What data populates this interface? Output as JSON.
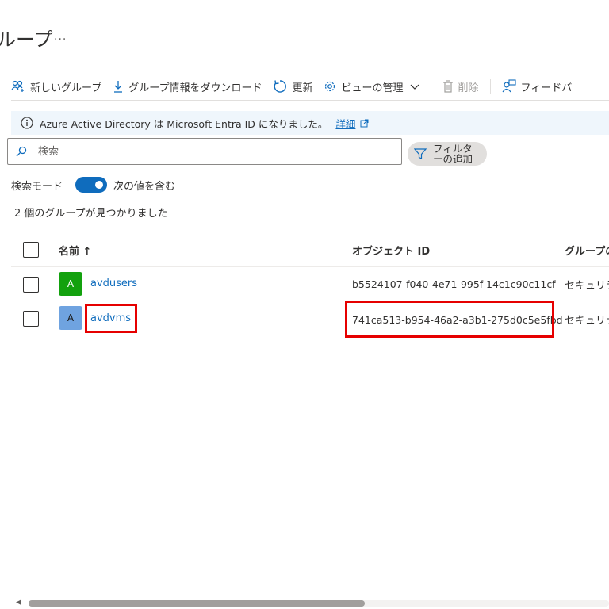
{
  "page": {
    "title": "ループ",
    "more": "..."
  },
  "toolbar": {
    "new_group": "新しいグループ",
    "download": "グループ情報をダウンロード",
    "refresh": "更新",
    "manage_view": "ビューの管理",
    "delete": "削除",
    "feedback": "フィードバ"
  },
  "banner": {
    "message": "Azure Active Directory は Microsoft Entra ID になりました。",
    "link": "詳細"
  },
  "search": {
    "placeholder": "検索"
  },
  "filter": {
    "label": "フィルターの追加"
  },
  "mode": {
    "label": "検索モード",
    "value": "次の値を含む",
    "enabled": true
  },
  "results": {
    "count_text": "2 個のグループが見つかりました"
  },
  "table": {
    "columns": {
      "name": "名前 ↑",
      "object_id": "オブジェクト ID",
      "group_type": "グループの"
    },
    "rows": [
      {
        "initial": "A",
        "avatar_color": "#13a10e",
        "name": "avdusers",
        "object_id": "b5524107-f040-4e71-995f-14c1c90c11cf",
        "type": "セキュリテ"
      },
      {
        "initial": "A",
        "avatar_color": "#6fa3e0",
        "name": "avdvms",
        "object_id": "741ca513-b954-46a2-a3b1-275d0c5e5fbd",
        "type": "セキュリテ"
      }
    ]
  },
  "colors": {
    "accent": "#0f6cbd",
    "highlight": "#e60000",
    "banner_bg": "#eff6fc"
  }
}
